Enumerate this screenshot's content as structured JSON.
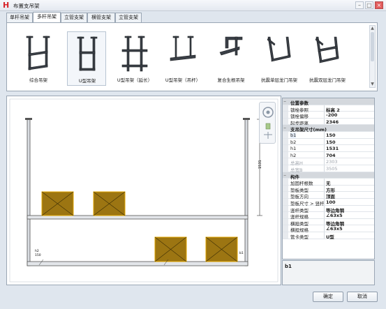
{
  "window": {
    "title": "布置支吊架",
    "logo_letter": "H",
    "minimize": "–",
    "maximize": "□",
    "close": "×"
  },
  "tabs": [
    {
      "label": "单杆吊架"
    },
    {
      "label": "多杆吊架"
    },
    {
      "label": "立管支架"
    },
    {
      "label": "横管支架"
    },
    {
      "label": "立管支架"
    }
  ],
  "active_tab": 1,
  "gallery": {
    "items": [
      {
        "label": "综合吊架"
      },
      {
        "label": "U型吊架"
      },
      {
        "label": "U型吊架（延长）"
      },
      {
        "label": "U型吊架（吊杆）"
      },
      {
        "label": "复合生根吊架"
      },
      {
        "label": "抗震单层龙门吊架"
      },
      {
        "label": "抗震双层龙门吊架"
      }
    ],
    "selected": 1,
    "scroll_up": "▲",
    "scroll_down": "▼"
  },
  "drawing": {
    "dim_label": "1531",
    "left_mark_top": "h2",
    "left_mark_bottom": "150",
    "right_mark": "b1"
  },
  "properties": {
    "sections": [
      {
        "title": "位置参数",
        "rows": [
          {
            "key": "锁栓参照",
            "value": "标高 2",
            "disabled": false
          },
          {
            "key": "锁栓偏移",
            "value": "-200",
            "disabled": false
          },
          {
            "key": "起步距离",
            "value": "2346",
            "disabled": false
          }
        ]
      },
      {
        "title": "支吊架尺寸(mm)",
        "rows": [
          {
            "key": "b1",
            "value": "150",
            "disabled": false
          },
          {
            "key": "b2",
            "value": "150",
            "disabled": false
          },
          {
            "key": "h1",
            "value": "1531",
            "disabled": false
          },
          {
            "key": "h2",
            "value": "704",
            "disabled": false
          },
          {
            "key": "总高H",
            "value": "2303",
            "disabled": true
          },
          {
            "key": "总宽B",
            "value": "3505",
            "disabled": true
          }
        ]
      },
      {
        "title": "构件",
        "rows": [
          {
            "key": "加固杆根数",
            "value": "无",
            "disabled": false
          },
          {
            "key": "垫板类型",
            "value": "方形",
            "disabled": false
          },
          {
            "key": "垫板方向",
            "value": "顶面",
            "disabled": false
          },
          {
            "key": "垫板尺寸 > 竖杆",
            "value": "100",
            "disabled": false
          },
          {
            "key": "竖杆类型",
            "value": "等边角钢",
            "disabled": false
          },
          {
            "key": "竖杆规格",
            "value": "∠63x5",
            "disabled": false
          },
          {
            "key": "横担类型",
            "value": "等边角钢",
            "disabled": false
          },
          {
            "key": "横担规格",
            "value": "∠63x5",
            "disabled": false
          },
          {
            "key": "管卡类型",
            "value": "U型",
            "disabled": false
          }
        ]
      }
    ],
    "collapse_glyph": "−"
  },
  "description": {
    "text": "b1"
  },
  "buttons": {
    "ok": "确定",
    "cancel": "取消"
  },
  "colors": {
    "pipe_fill": "#9c7512",
    "pipe_stroke": "#e0a500",
    "selected_row": "#e8f0fb"
  }
}
